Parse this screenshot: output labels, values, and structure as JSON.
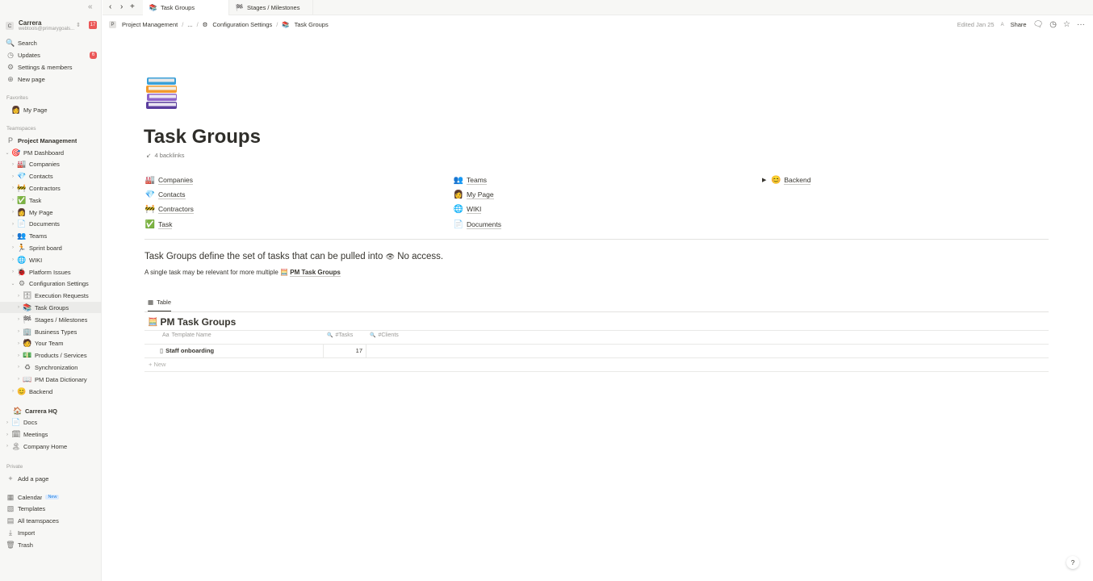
{
  "workspace": {
    "avatar": "C",
    "name": "Carrera",
    "email": "webtools@primarygoals...",
    "badge": "17"
  },
  "sidebar_top": [
    {
      "label": "Search",
      "icon": "🔍"
    },
    {
      "label": "Updates",
      "icon": "◷",
      "badge": "6"
    },
    {
      "label": "Settings & members",
      "icon": "⚙"
    },
    {
      "label": "New page",
      "icon": "⊕"
    }
  ],
  "sections": {
    "favorites": "Favorites",
    "teamspaces": "Teamspaces",
    "private": "Private"
  },
  "favorites": [
    {
      "label": "My Page",
      "icon": "👩"
    }
  ],
  "teamspace_header": {
    "label": "Project Management",
    "icon": "P"
  },
  "tree": [
    {
      "label": "PM Dashboard",
      "icon": "🎯",
      "chev": "⌄",
      "indent": 0
    },
    {
      "label": "Companies",
      "icon": "🏭",
      "chev": "›",
      "indent": 1
    },
    {
      "label": "Contacts",
      "icon": "💎",
      "chev": "›",
      "indent": 1
    },
    {
      "label": "Contractors",
      "icon": "🚧",
      "chev": "›",
      "indent": 1
    },
    {
      "label": "Task",
      "icon": "✅",
      "chev": "›",
      "indent": 1
    },
    {
      "label": "My Page",
      "icon": "👩",
      "chev": "›",
      "indent": 1
    },
    {
      "label": "Documents",
      "icon": "📄",
      "chev": "›",
      "indent": 1
    },
    {
      "label": "Teams",
      "icon": "👥",
      "chev": "›",
      "indent": 1
    },
    {
      "label": "Sprint board",
      "icon": "🏃",
      "chev": "›",
      "indent": 1
    },
    {
      "label": "WIKI",
      "icon": "🌐",
      "chev": "›",
      "indent": 1
    },
    {
      "label": "Platform Issues",
      "icon": "🐞",
      "chev": "›",
      "indent": 1
    },
    {
      "label": "Configuration Settings",
      "icon": "⚙",
      "chev": "⌄",
      "indent": 1
    },
    {
      "label": "Execution Requests",
      "icon": "🗄",
      "chev": "›",
      "indent": 2
    },
    {
      "label": "Task Groups",
      "icon": "📚",
      "chev": "›",
      "indent": 2,
      "selected": true
    },
    {
      "label": "Stages / Milestones",
      "icon": "🏁",
      "chev": "›",
      "indent": 2
    },
    {
      "label": "Business Types",
      "icon": "🏢",
      "chev": "›",
      "indent": 2
    },
    {
      "label": "Your Team",
      "icon": "🧑",
      "chev": "›",
      "indent": 2
    },
    {
      "label": "Products / Services",
      "icon": "💵",
      "chev": "›",
      "indent": 2
    },
    {
      "label": "Synchronization",
      "icon": "♻",
      "chev": "›",
      "indent": 2
    },
    {
      "label": "PM Data Dictionary",
      "icon": "📖",
      "chev": "›",
      "indent": 2
    },
    {
      "label": "Backend",
      "icon": "😊",
      "chev": "›",
      "indent": 1
    }
  ],
  "teamspace2": [
    {
      "label": "Carrera HQ",
      "icon": "🏠",
      "chev": ""
    },
    {
      "label": "Docs",
      "icon": "📄",
      "chev": "›"
    },
    {
      "label": "Meetings",
      "icon": "🗓",
      "chev": "›"
    },
    {
      "label": "Company Home",
      "icon": "🏝",
      "chev": "›"
    }
  ],
  "private": [
    {
      "label": "Add a page",
      "icon": "+"
    }
  ],
  "bottom": [
    {
      "label": "Calendar",
      "icon": "▦",
      "new": "New"
    },
    {
      "label": "Templates",
      "icon": "▧"
    },
    {
      "label": "All teamspaces",
      "icon": "▤"
    },
    {
      "label": "Import",
      "icon": "⤓"
    },
    {
      "label": "Trash",
      "icon": "🗑"
    }
  ],
  "tabs": [
    {
      "label": "Task Groups",
      "icon": "📚"
    },
    {
      "label": "Stages / Milestones",
      "icon": "🏁"
    }
  ],
  "breadcrumbs": [
    {
      "label": "Project Management",
      "icon": "P"
    },
    {
      "label": "...",
      "icon": ""
    },
    {
      "label": "Configuration Settings",
      "icon": "⚙"
    },
    {
      "label": "Task Groups",
      "icon": "📚"
    }
  ],
  "topbar": {
    "edited": "Edited Jan 25",
    "avatar": "A",
    "share": "Share"
  },
  "page": {
    "icon": "📚",
    "title": "Task Groups",
    "backlinks": "4 backlinks",
    "links_col1": [
      {
        "label": "Companies",
        "icon": "🏭"
      },
      {
        "label": "Contacts",
        "icon": "💎"
      },
      {
        "label": "Contractors",
        "icon": "🚧"
      },
      {
        "label": "Task",
        "icon": "✅"
      }
    ],
    "links_col2": [
      {
        "label": "Teams",
        "icon": "👥"
      },
      {
        "label": "My Page",
        "icon": "👩"
      },
      {
        "label": "WIKI",
        "icon": "🌐"
      },
      {
        "label": "Documents",
        "icon": "📄"
      }
    ],
    "links_col3": [
      {
        "label": "Backend",
        "icon": "😊"
      }
    ],
    "heading": "Task Groups define the set of tasks that can be pulled into",
    "heading_icon": "👁",
    "heading_noaccess": "No access.",
    "subtext": "A single task may be relevant for more multiple",
    "subtext_link": "PM Task Groups",
    "subtext_icon": "🧮"
  },
  "database": {
    "view_tab": "Table",
    "title": "PM Task Groups",
    "title_icon": "🧮",
    "columns": [
      {
        "label": "Template Name",
        "icon": "Aa"
      },
      {
        "label": "#Tasks",
        "icon": "🔍"
      },
      {
        "label": "#Clients",
        "icon": "🔍"
      }
    ],
    "rows": [
      {
        "name": "Staff onboarding",
        "tasks": "17",
        "clients": ""
      }
    ],
    "new_label": "New"
  },
  "help": "?"
}
